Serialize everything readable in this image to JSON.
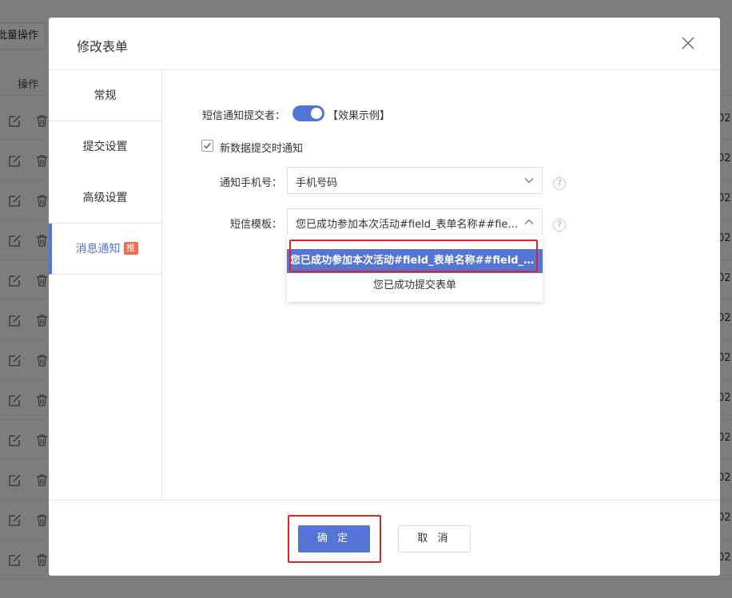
{
  "background": {
    "batch_button_label": "批量操作",
    "column_header": "操作",
    "row_cell_text": "02",
    "row_count": 12
  },
  "modal": {
    "title": "修改表单",
    "close_icon": "close-icon",
    "sidebar": {
      "items": [
        {
          "label": "常规"
        },
        {
          "label": "提交设置"
        },
        {
          "label": "高级设置"
        },
        {
          "label": "消息通知",
          "badge": "推",
          "active": true
        }
      ]
    },
    "form": {
      "sms_notify_label": "短信通知提交者：",
      "toggle_on": true,
      "example_link": "【效果示例】",
      "new_data_checkbox": {
        "label": "新数据提交时通知",
        "checked": true
      },
      "phone_field": {
        "label": "通知手机号：",
        "value": "手机号码"
      },
      "template_field": {
        "label": "短信模板：",
        "value": "您已成功参加本次活动#field_表单名称##field_表单..."
      },
      "help_icon": "?",
      "dropdown_options": [
        {
          "label": "您已成功参加本次活动#field_表单名称##field_表单...",
          "selected": true
        },
        {
          "label": "您已成功提交表单",
          "selected": false
        }
      ]
    },
    "footer": {
      "ok_label": "确 定",
      "cancel_label": "取 消"
    }
  },
  "colors": {
    "accent": "#5475d6",
    "badge": "#f06e4f",
    "highlight_frame": "#e3231c"
  }
}
